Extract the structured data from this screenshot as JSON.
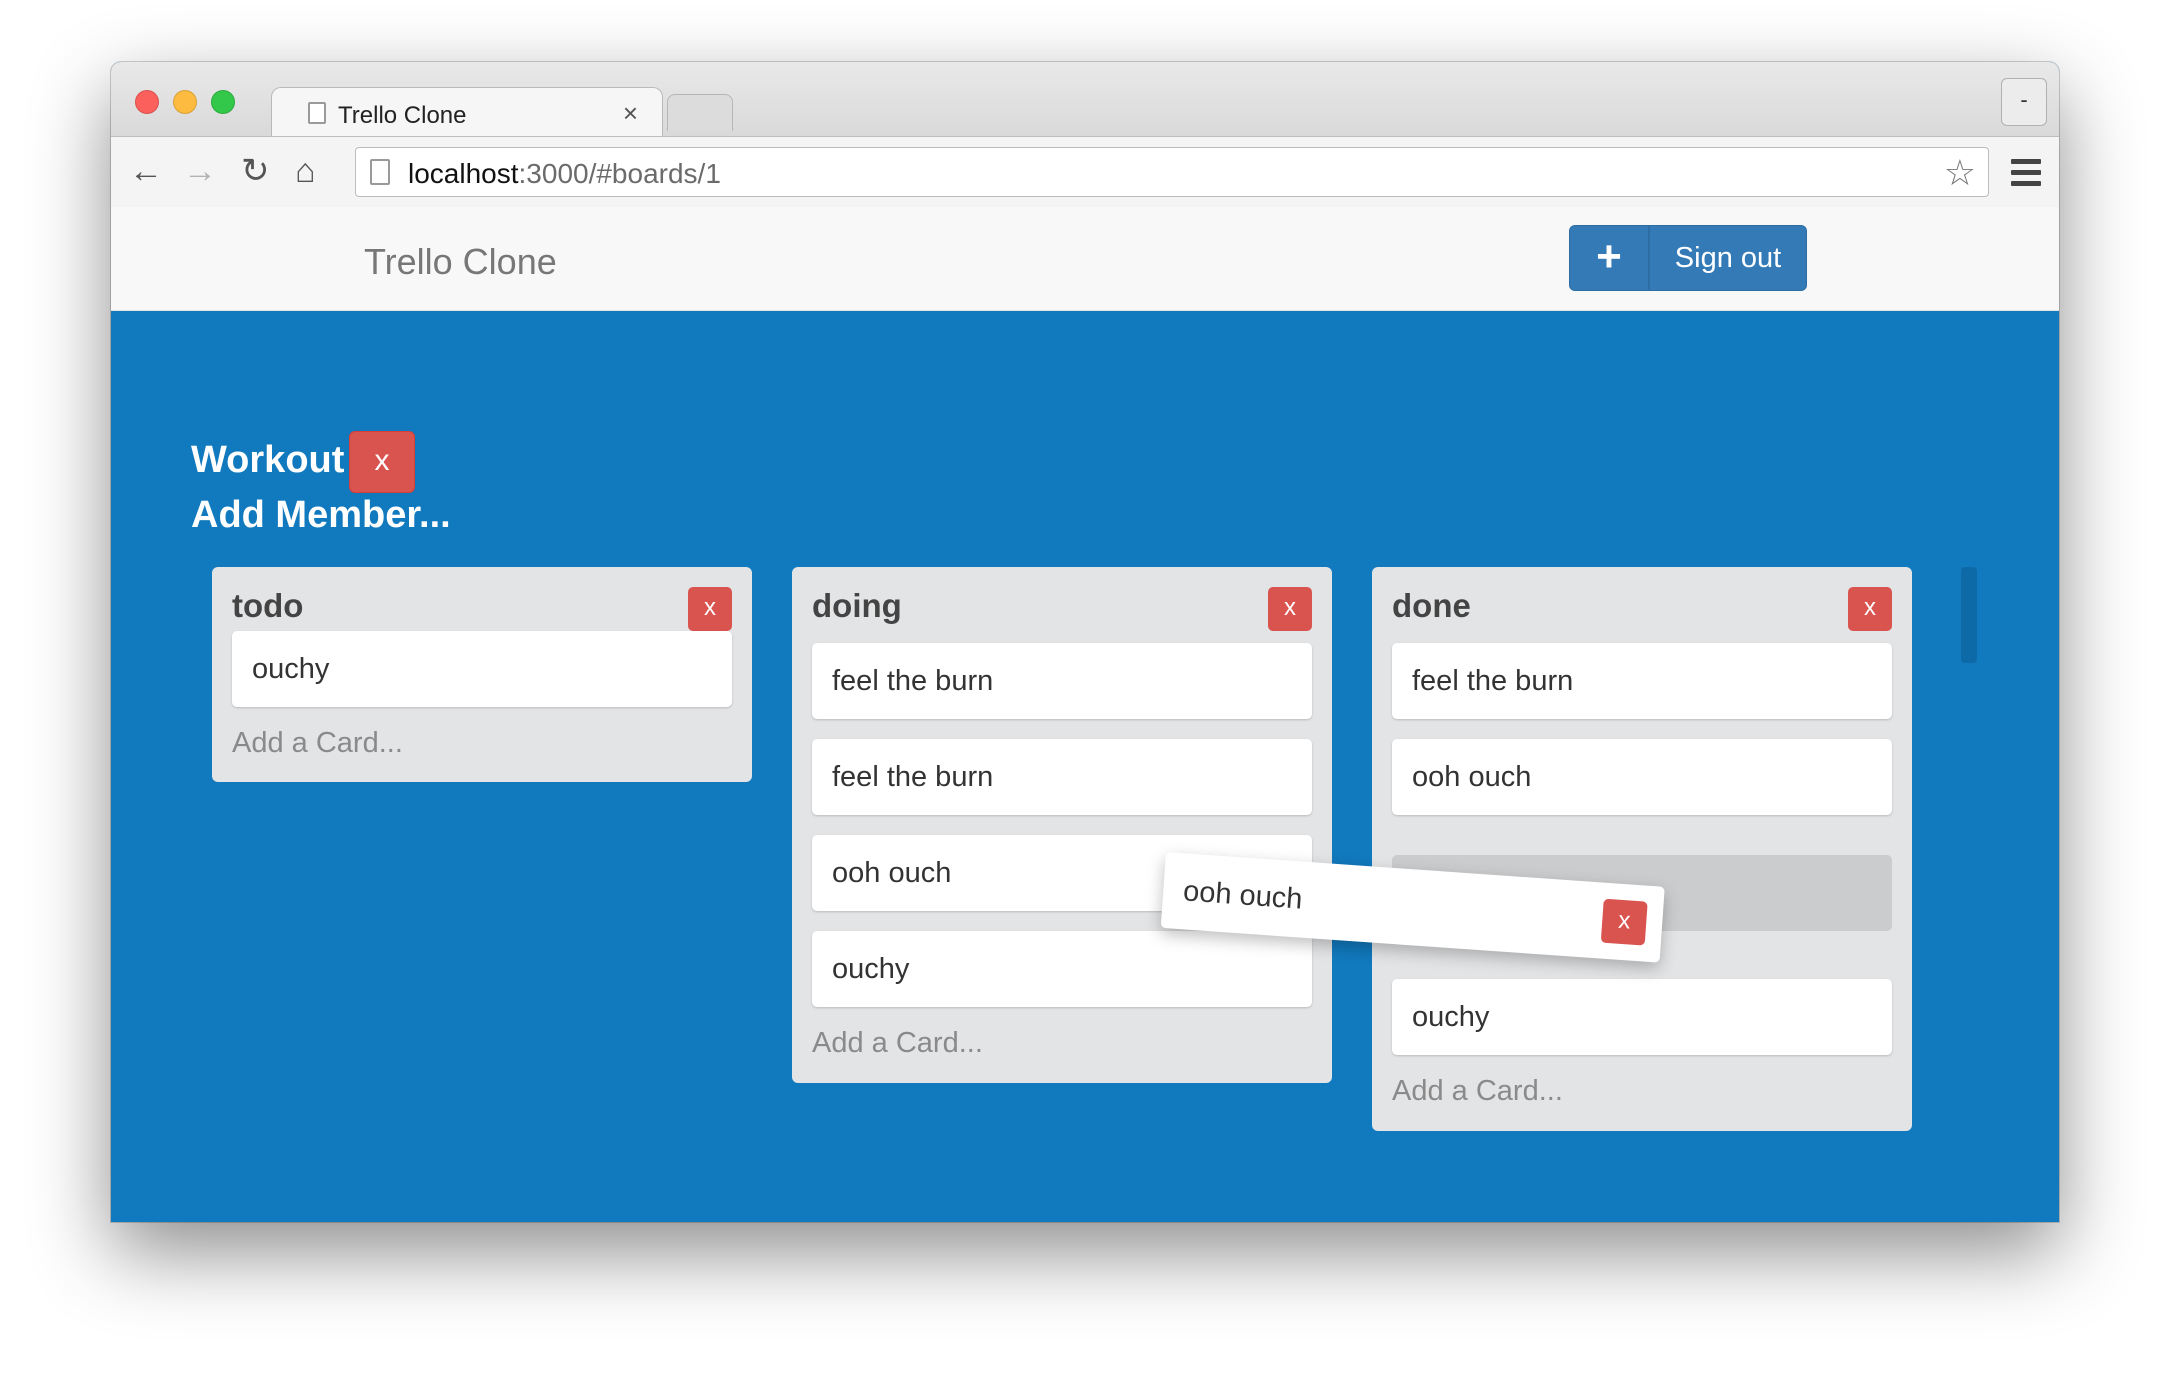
{
  "browser": {
    "tab_title": "Trello Clone",
    "tab_close": "×",
    "window_button": "-",
    "url_host": "localhost",
    "url_rest": ":3000/#boards/1",
    "back": "←",
    "forward": "→",
    "reload": "↻",
    "home": "⌂",
    "star": "☆"
  },
  "navbar": {
    "brand": "Trello Clone",
    "add_label": "+",
    "signout_label": "Sign out"
  },
  "board": {
    "title": "Workout",
    "delete_label": "x",
    "add_member": "Add Member..."
  },
  "lists": [
    {
      "title": "todo",
      "delete_label": "x",
      "cards": [
        "ouchy"
      ],
      "add_card": "Add a Card..."
    },
    {
      "title": "doing",
      "delete_label": "x",
      "cards": [
        "feel the burn",
        "feel the burn",
        "ooh ouch",
        "ouchy"
      ],
      "add_card": "Add a Card..."
    },
    {
      "title": "done",
      "delete_label": "x",
      "cards": [
        "feel the burn",
        "ooh ouch",
        "ouchy"
      ],
      "add_card": "Add a Card..."
    }
  ],
  "dragging_card": {
    "label": "ooh ouch",
    "delete_label": "x"
  },
  "colors": {
    "board_background": "#1179bd",
    "primary_button": "#337ab7",
    "danger_button": "#d9534f",
    "list_background": "#e3e4e6"
  }
}
